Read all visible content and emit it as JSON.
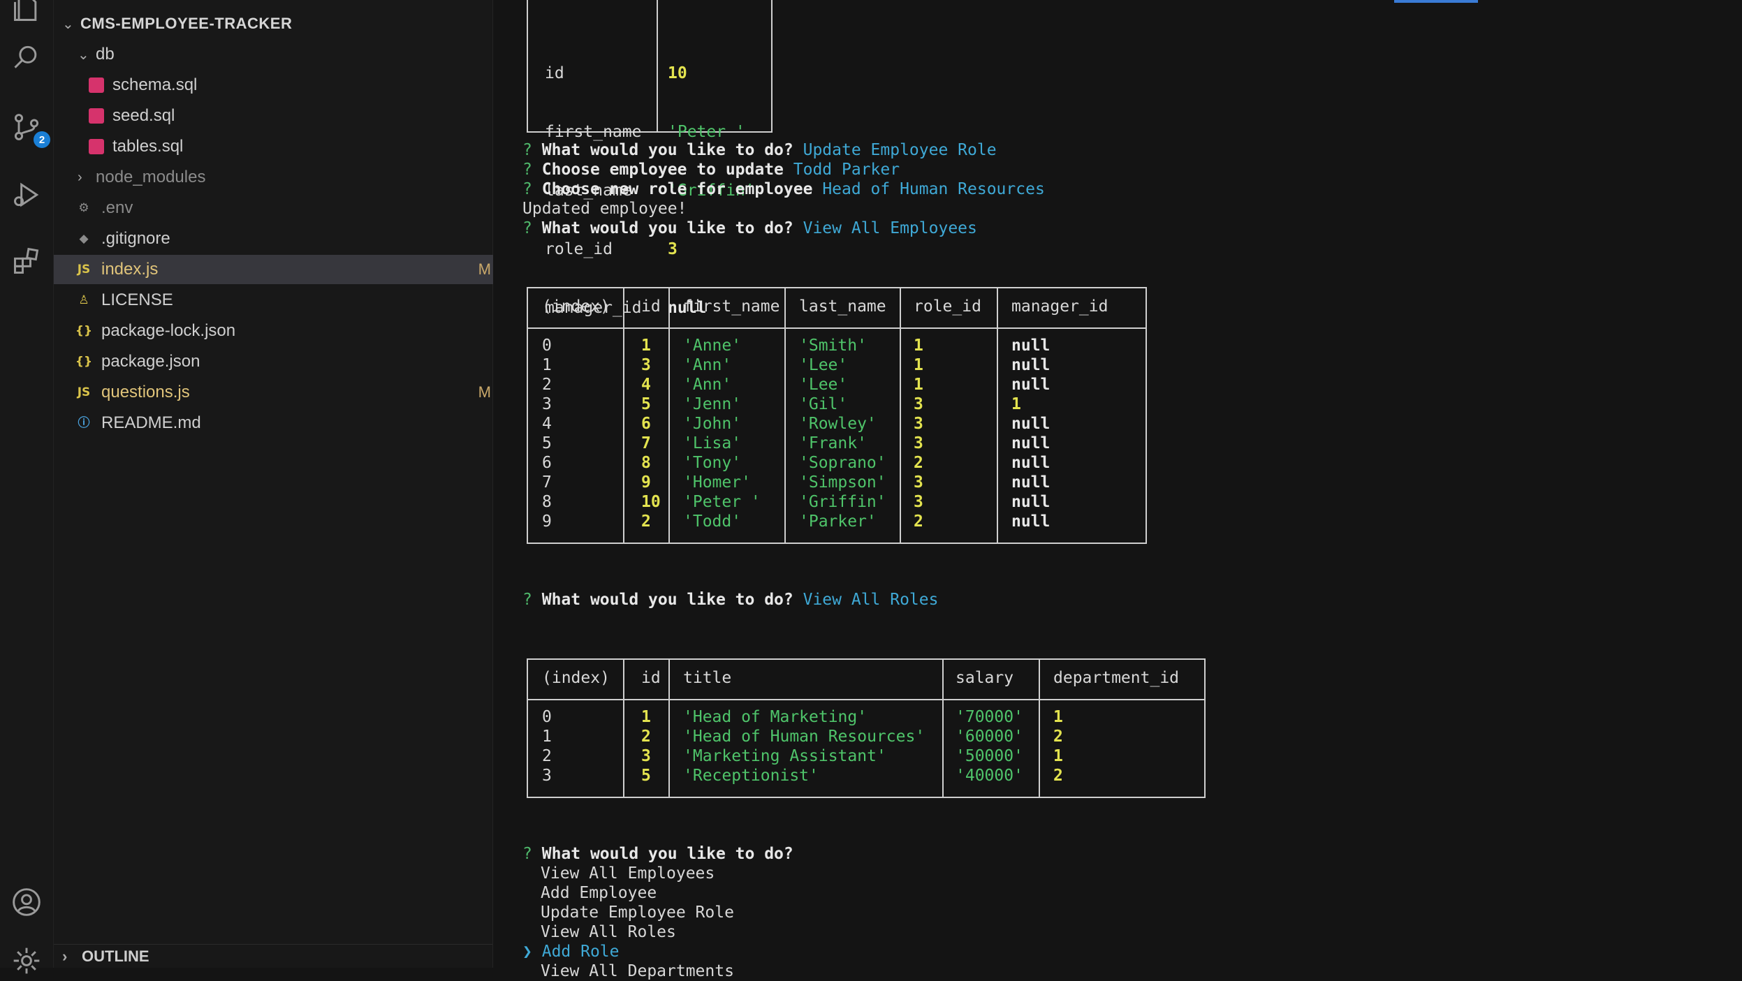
{
  "activity_bar": {
    "items": [
      {
        "name": "explorer-icon"
      },
      {
        "name": "search-icon"
      },
      {
        "name": "source-control-icon",
        "badge": "2"
      },
      {
        "name": "run-debug-icon"
      },
      {
        "name": "extensions-icon"
      },
      {
        "name": "account-icon"
      },
      {
        "name": "settings-icon"
      }
    ]
  },
  "explorer": {
    "project": "CMS-EMPLOYEE-TRACKER",
    "folder_db": "db",
    "files_db": [
      "schema.sql",
      "seed.sql",
      "tables.sql"
    ],
    "node_modules": "node_modules",
    "env": ".env",
    "gitignore": ".gitignore",
    "index": "index.js",
    "index_status": "M",
    "license": "LICENSE",
    "package_lock": "package-lock.json",
    "package": "package.json",
    "questions": "questions.js",
    "questions_status": "M",
    "readme": "README.md",
    "outline": "OUTLINE"
  },
  "terminal": {
    "record": {
      "keys": [
        "id",
        "first_name",
        "last_name",
        "role_id",
        "manager_id"
      ],
      "values": [
        "10",
        "'Peter '",
        "'Griffin'",
        "3",
        "null"
      ]
    },
    "prompts": {
      "q_mark": "?",
      "what": "What would you like to do?",
      "choose_emp": "Choose employee to update",
      "choose_role": "Choose new role for employee",
      "ans_update": "Update Employee Role",
      "ans_emp": "Todd Parker",
      "ans_role": "Head of Human Resources",
      "updated": "Updated employee!",
      "ans_view_emp": "View All Employees",
      "ans_view_roles": "View All Roles"
    },
    "employees_table": {
      "headers": [
        "(index)",
        "id",
        "first_name",
        "last_name",
        "role_id",
        "manager_id"
      ],
      "rows": [
        [
          "0",
          "1",
          "'Anne'",
          "'Smith'",
          "1",
          "null"
        ],
        [
          "1",
          "3",
          "'Ann'",
          "'Lee'",
          "1",
          "null"
        ],
        [
          "2",
          "4",
          "'Ann'",
          "'Lee'",
          "1",
          "null"
        ],
        [
          "3",
          "5",
          "'Jenn'",
          "'Gil'",
          "3",
          "1"
        ],
        [
          "4",
          "6",
          "'John'",
          "'Rowley'",
          "3",
          "null"
        ],
        [
          "5",
          "7",
          "'Lisa'",
          "'Frank'",
          "3",
          "null"
        ],
        [
          "6",
          "8",
          "'Tony'",
          "'Soprano'",
          "2",
          "null"
        ],
        [
          "7",
          "9",
          "'Homer'",
          "'Simpson'",
          "3",
          "null"
        ],
        [
          "8",
          "10",
          "'Peter '",
          "'Griffin'",
          "3",
          "null"
        ],
        [
          "9",
          "2",
          "'Todd'",
          "'Parker'",
          "2",
          "null"
        ]
      ]
    },
    "roles_table": {
      "headers": [
        "(index)",
        "id",
        "title",
        "salary",
        "department_id"
      ],
      "rows": [
        [
          "0",
          "1",
          "'Head of Marketing'",
          "'70000'",
          "1"
        ],
        [
          "1",
          "2",
          "'Head of Human Resources'",
          "'60000'",
          "2"
        ],
        [
          "2",
          "3",
          "'Marketing Assistant'",
          "'50000'",
          "1"
        ],
        [
          "3",
          "5",
          "'Receptionist'",
          "'40000'",
          "2"
        ]
      ]
    },
    "menu": {
      "options": [
        "View All Employees",
        "Add Employee",
        "Update Employee Role",
        "View All Roles",
        "Add Role",
        "View All Departments"
      ],
      "pointer": "❯"
    }
  },
  "colors": {
    "prompt": "#4fb86b",
    "answer": "#3fa9d6",
    "number": "#e3e34f",
    "string": "#4fc46a",
    "modified": "#c9a86a",
    "badge": "#1a7fd6"
  }
}
